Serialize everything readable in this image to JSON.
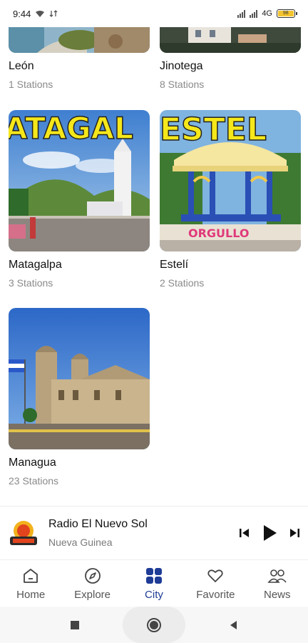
{
  "status_bar": {
    "time": "9:44",
    "network": "4G",
    "battery": "98"
  },
  "cities": [
    {
      "name": "León",
      "stations": "1 Stations"
    },
    {
      "name": "Jinotega",
      "stations": "8 Stations"
    },
    {
      "name": "Matagalpa",
      "stations": "3 Stations",
      "banner": "ATAGAL"
    },
    {
      "name": "Estelí",
      "stations": "2 Stations",
      "banner": "ESTEL",
      "plaque": "ORGULLO"
    },
    {
      "name": "Managua",
      "stations": "23 Stations"
    }
  ],
  "player": {
    "title": "Radio El Nuevo Sol",
    "subtitle": "Nueva Guinea"
  },
  "nav": {
    "items": [
      {
        "label": "Home",
        "icon": "home-icon"
      },
      {
        "label": "Explore",
        "icon": "compass-icon"
      },
      {
        "label": "City",
        "icon": "grid-icon"
      },
      {
        "label": "Favorite",
        "icon": "heart-icon"
      },
      {
        "label": "News",
        "icon": "people-icon"
      }
    ],
    "active": "City"
  },
  "colors": {
    "accent": "#1e3c96",
    "muted_text": "#8a8a8a",
    "banner_yellow": "#f5e71a"
  }
}
